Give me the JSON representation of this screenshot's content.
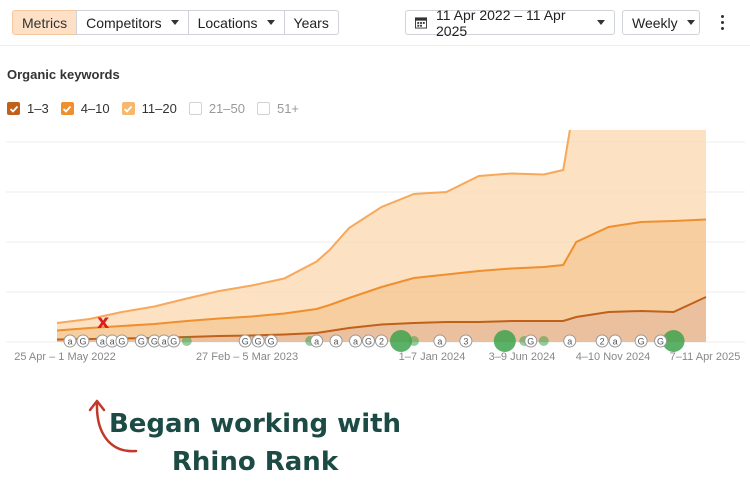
{
  "toolbar": {
    "tabs": [
      {
        "label": "Metrics",
        "active": true
      },
      {
        "label": "Competitors",
        "dropdown": true
      },
      {
        "label": "Locations",
        "dropdown": true
      },
      {
        "label": "Years"
      }
    ],
    "date_range": "11 Apr 2022 – 11 Apr 2025",
    "interval": "Weekly"
  },
  "section_title": "Organic keywords",
  "legend": [
    {
      "label": "1–3",
      "checked": true,
      "color": "#c0601a"
    },
    {
      "label": "4–10",
      "checked": true,
      "color": "#ef8f2e"
    },
    {
      "label": "11–20",
      "checked": true,
      "color": "#f5b86c"
    },
    {
      "label": "21–50",
      "checked": false
    },
    {
      "label": "51+",
      "checked": false
    }
  ],
  "chart_data": {
    "type": "area",
    "stacked": true,
    "title": "Organic keywords",
    "x_tick_labels": [
      "25 Apr – 1 May 2022",
      "27 Feb – 5 Mar 2023",
      "1–7 Jan 2024",
      "3–9 Jun 2024",
      "4–10 Nov 2024",
      "7–11 Apr 2025"
    ],
    "ylim": [
      0,
      400
    ],
    "grid": true,
    "y_axis_labels_shown": false,
    "x": [
      0,
      0.05,
      0.1,
      0.15,
      0.2,
      0.25,
      0.3,
      0.35,
      0.4,
      0.42,
      0.45,
      0.5,
      0.55,
      0.6,
      0.65,
      0.7,
      0.75,
      0.78,
      0.8,
      0.85,
      0.9,
      0.95,
      1.0
    ],
    "series": [
      {
        "name": "1–3",
        "color": "#c0601a",
        "values": [
          5,
          6,
          7,
          8,
          10,
          12,
          13,
          15,
          18,
          22,
          28,
          35,
          38,
          40,
          40,
          42,
          42,
          42,
          50,
          60,
          62,
          60,
          90
        ]
      },
      {
        "name": "4–10",
        "color": "#ef8f2e",
        "values": [
          18,
          22,
          25,
          28,
          32,
          35,
          38,
          42,
          48,
          52,
          60,
          75,
          90,
          95,
          102,
          105,
          108,
          112,
          150,
          170,
          178,
          182,
          155
        ]
      },
      {
        "name": "11–20",
        "color": "#f5b86c",
        "values": [
          15,
          18,
          28,
          35,
          45,
          55,
          62,
          70,
          95,
          110,
          140,
          160,
          168,
          165,
          190,
          190,
          185,
          190,
          300,
          305,
          310,
          335,
          305
        ]
      }
    ],
    "event_markers": [
      {
        "x": 0.02,
        "label": "a"
      },
      {
        "x": 0.04,
        "label": "G"
      },
      {
        "x": 0.07,
        "label": "a"
      },
      {
        "x": 0.085,
        "label": "a"
      },
      {
        "x": 0.1,
        "label": "G"
      },
      {
        "x": 0.13,
        "label": "G"
      },
      {
        "x": 0.15,
        "label": "G"
      },
      {
        "x": 0.165,
        "label": "a"
      },
      {
        "x": 0.18,
        "label": "G"
      },
      {
        "x": 0.29,
        "label": "G"
      },
      {
        "x": 0.31,
        "label": "G"
      },
      {
        "x": 0.33,
        "label": "G"
      },
      {
        "x": 0.4,
        "label": "a"
      },
      {
        "x": 0.43,
        "label": "a"
      },
      {
        "x": 0.46,
        "label": "a"
      },
      {
        "x": 0.48,
        "label": "G"
      },
      {
        "x": 0.5,
        "label": "2"
      },
      {
        "x": 0.59,
        "label": "a"
      },
      {
        "x": 0.63,
        "label": "3"
      },
      {
        "x": 0.73,
        "label": "G"
      },
      {
        "x": 0.79,
        "label": "a"
      },
      {
        "x": 0.84,
        "label": "2"
      },
      {
        "x": 0.86,
        "label": "a"
      },
      {
        "x": 0.9,
        "label": "G"
      },
      {
        "x": 0.93,
        "label": "G"
      }
    ],
    "green_events": [
      {
        "x": 0.2,
        "size": "small"
      },
      {
        "x": 0.31,
        "size": "small"
      },
      {
        "x": 0.39,
        "size": "small"
      },
      {
        "x": 0.53,
        "size": "large"
      },
      {
        "x": 0.55,
        "size": "small"
      },
      {
        "x": 0.69,
        "size": "large"
      },
      {
        "x": 0.72,
        "size": "small"
      },
      {
        "x": 0.75,
        "size": "small"
      },
      {
        "x": 0.84,
        "size": "small"
      },
      {
        "x": 0.95,
        "size": "large"
      }
    ]
  },
  "annotation": {
    "marker": "x",
    "text_line1": "Began working with",
    "text_line2": "Rhino Rank"
  }
}
